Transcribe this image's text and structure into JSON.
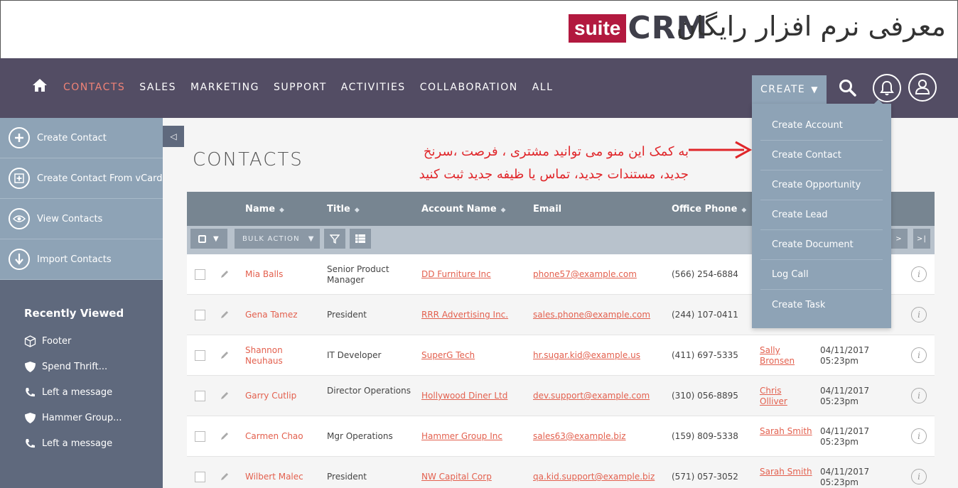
{
  "banner": {
    "title": "معرفی نرم افزار رایگان",
    "logo_suite": "suite",
    "logo_crm": "CRM"
  },
  "nav": {
    "items": [
      "CONTACTS",
      "SALES",
      "MARKETING",
      "SUPPORT",
      "ACTIVITIES",
      "COLLABORATION",
      "ALL"
    ],
    "create_label": "CREATE"
  },
  "sidebar": {
    "actions": [
      "Create Contact",
      "Create Contact From vCard",
      "View Contacts",
      "Import Contacts"
    ],
    "recent_title": "Recently Viewed",
    "recent": [
      "Footer",
      "Spend Thrift...",
      "Left a message",
      "Hammer Group...",
      "Left a message"
    ]
  },
  "main": {
    "page_title": "CONTACTS",
    "annotation_line1": "به کمک این منو می توانید مشتری ، فرصت ،سرنخ",
    "annotation_line2": "جدید، مستندات جدید، تماس یا ظیفه جدید ثبت کنید",
    "bulk_action": "BULK ACTION",
    "columns": [
      "Name",
      "Title",
      "Account Name",
      "Email",
      "Office Phone"
    ],
    "rows": [
      {
        "name": "Mia Balls",
        "title": "Senior Product Manager",
        "account": "DD Furniture Inc",
        "email": "phone57@example.com",
        "phone": "(566) 254-6884",
        "user": "",
        "date": ""
      },
      {
        "name": "Gena Tamez",
        "title": "President",
        "account": "RRR Advertising Inc.",
        "email": "sales.phone@example.com",
        "phone": "(244) 107-0411",
        "user": "",
        "date": ""
      },
      {
        "name": "Shannon Neuhaus",
        "title": "IT Developer",
        "account": "SuperG Tech",
        "email": "hr.sugar.kid@example.us",
        "phone": "(411) 697-5335",
        "user": "Sally Bronsen",
        "date": "04/11/2017 05:23pm"
      },
      {
        "name": "Garry Cutlip",
        "title": "Director Operations",
        "account": "Hollywood Diner Ltd",
        "email": "dev.support@example.com",
        "phone": "(310) 056-8895",
        "user": "Chris Olliver",
        "date": "04/11/2017 05:23pm"
      },
      {
        "name": "Carmen Chao",
        "title": "Mgr Operations",
        "account": "Hammer Group Inc",
        "email": "sales63@example.biz",
        "phone": "(159) 809-5338",
        "user": "Sarah Smith",
        "date": "04/11/2017 05:23pm"
      },
      {
        "name": "Wilbert Malec",
        "title": "President",
        "account": "NW Capital Corp",
        "email": "qa.kid.support@example.biz",
        "phone": "(571) 057-3052",
        "user": "Sarah Smith",
        "date": "04/11/2017 05:23pm"
      }
    ]
  },
  "create_menu": [
    "Create Account",
    "Create Contact",
    "Create Opportunity",
    "Create Lead",
    "Create Document",
    "Log Call",
    "Create Task"
  ]
}
